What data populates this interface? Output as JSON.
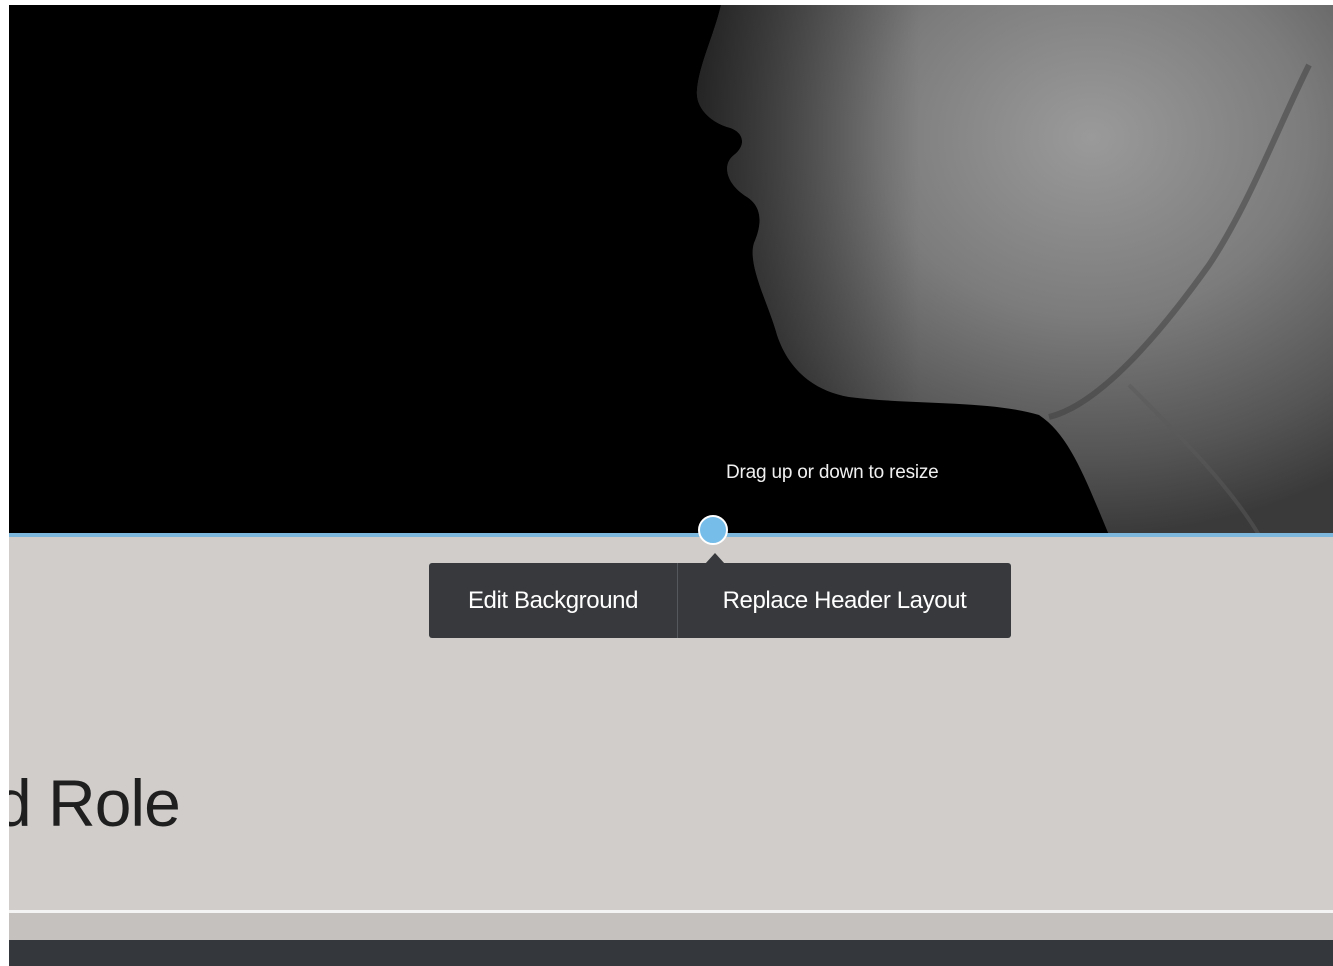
{
  "header": {
    "image_name": "face-profile-photo",
    "resize_hint": "Drag up or down to resize"
  },
  "toolbar": {
    "edit_background_label": "Edit Background",
    "replace_header_label": "Replace Header Layout"
  },
  "content": {
    "heading_fragment": "d Role"
  },
  "colors": {
    "accent": "#7db8dc",
    "handle": "#76bde9",
    "toolbar_bg": "#37393c",
    "page_bg": "#d0cdca",
    "footer_bg": "#34373b"
  }
}
